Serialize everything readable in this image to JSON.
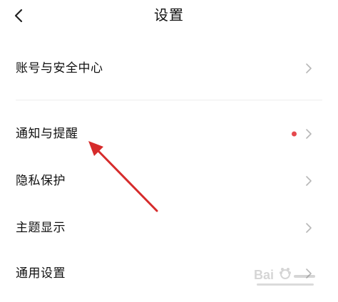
{
  "header": {
    "back_icon": "chevron-left-icon",
    "title": "设置"
  },
  "settings": {
    "items": [
      {
        "label": "账号与安全中心",
        "has_dot": false,
        "dot_color": ""
      },
      {
        "label": "通知与提醒",
        "has_dot": true,
        "dot_color": "#e5484d"
      },
      {
        "label": "隐私保护",
        "has_dot": false,
        "dot_color": ""
      },
      {
        "label": "主题显示",
        "has_dot": false,
        "dot_color": ""
      },
      {
        "label": "通用设置",
        "has_dot": false,
        "dot_color": ""
      }
    ]
  },
  "annotation": {
    "arrow_color": "#d62b2b"
  },
  "watermark": {
    "visible": true,
    "brand": "Baidu"
  }
}
